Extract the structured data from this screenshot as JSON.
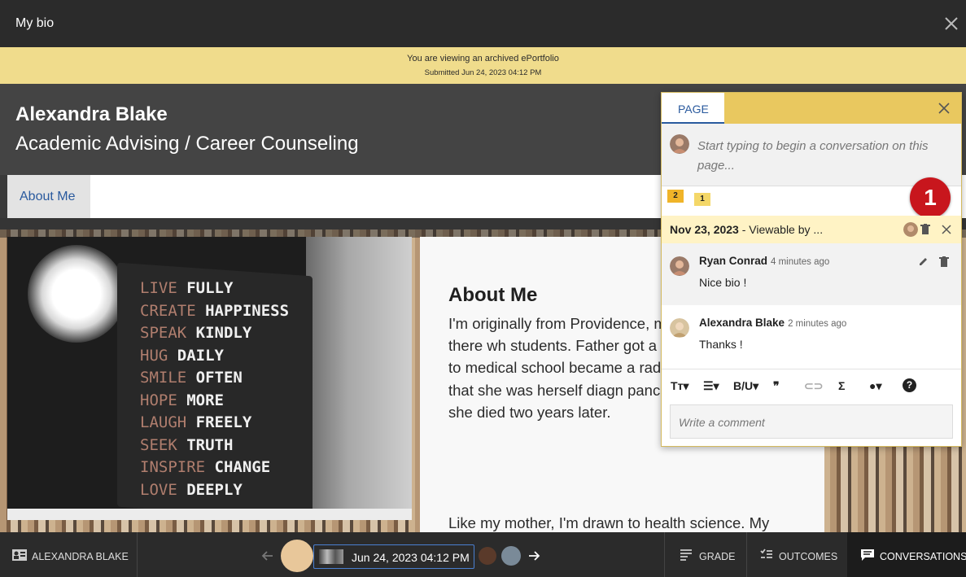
{
  "window": {
    "title": "My bio"
  },
  "banner": {
    "line1": "You are viewing an archived ePortfolio",
    "line2": "Submitted Jun 24, 2023 04:12 PM"
  },
  "header": {
    "name": "Alexandra Blake",
    "role": "Academic Advising / Career Counseling"
  },
  "nav": {
    "tab_label": "About Me"
  },
  "photo_text": [
    {
      "a": "LIVE",
      "b": "FULLY"
    },
    {
      "a": "CREATE",
      "b": "HAPPINESS"
    },
    {
      "a": "SPEAK",
      "b": "KINDLY"
    },
    {
      "a": "HUG",
      "b": "DAILY"
    },
    {
      "a": "SMILE",
      "b": "OFTEN"
    },
    {
      "a": "HOPE",
      "b": "MORE"
    },
    {
      "a": "LAUGH",
      "b": "FREELY"
    },
    {
      "a": "SEEK",
      "b": "TRUTH"
    },
    {
      "a": "INSPIRE",
      "b": "CHANGE"
    },
    {
      "a": "LOVE",
      "b": "DEEPLY"
    }
  ],
  "content": {
    "heading": "About Me",
    "paragraph1": "I'm originally from Providence, mother and father met there wh students. Father got a degree i mother went to medical school became a radiological oncologi irony that she was herself diagn pancreatic cancer in 2016; she died two years later.",
    "paragraph2": "Like my mother, I'm drawn to health science. My"
  },
  "panel": {
    "tab_label": "PAGE",
    "compose_placeholder": "Start typing to begin a conversation on this page...",
    "flag1": "2",
    "flag2": "1",
    "badge": "1",
    "thread_date": "Nov 23, 2023",
    "thread_visibility": " - Viewable by ...",
    "messages": [
      {
        "author": "Ryan Conrad",
        "time": "4 minutes ago",
        "text": "Nice bio !"
      },
      {
        "author": "Alexandra Blake",
        "time": "2 minutes ago",
        "text": "Thanks !"
      }
    ],
    "toolbar": {
      "text_size": "Tт",
      "bold_italic": "B/U",
      "quote": "❞",
      "sigma": "Σ",
      "help": "?"
    },
    "comment_placeholder": "Write a comment"
  },
  "bottombar": {
    "user_label": "ALEXANDRA BLAKE",
    "submission_date": "Jun 24, 2023 04:12 PM",
    "grade_label": "GRADE",
    "outcomes_label": "OUTCOMES",
    "conversations_label": "CONVERSATIONS"
  },
  "colors": {
    "banner": "#f0dc8c",
    "accent_blue": "#2a5a9e",
    "badge_red": "#c8161d",
    "panel_tab_bar": "#e9c85f"
  }
}
